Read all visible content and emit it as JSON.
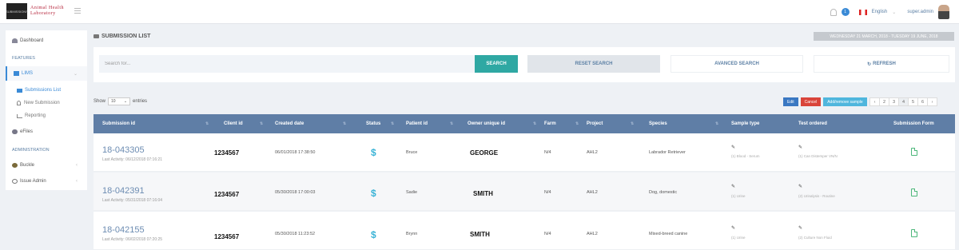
{
  "header": {
    "logo_box_text": "SUBMISSIONS",
    "logo_line1": "Animal Health",
    "logo_line2": "Laboratory",
    "notification_count": "1",
    "language": "English",
    "user": "super.admin"
  },
  "sidebar": {
    "dashboard": "Dashboard",
    "features_heading": "FEATURES",
    "lims": "LIMS",
    "submissions_list": "Submissions List",
    "new_submission": "New Submission",
    "reporting": "Reporting",
    "efiles": "eFiles",
    "admin_heading": "ADMINISTRATION",
    "buckle": "Buckle",
    "issue_admin": "Issue Admin"
  },
  "page": {
    "title": "SUBMISSION LIST",
    "date_range": "WEDNESDAY 21 MARCH, 2018 - TUESDAY 19 JUNE, 2018"
  },
  "search": {
    "placeholder": "Search for...",
    "search_label": "SEARCH",
    "reset_label": "RESET SEARCH",
    "advanced_label": "AVANCED SEARCH",
    "refresh_label": "REFRESH"
  },
  "table_controls": {
    "show_label": "Show",
    "entries_value": "10",
    "entries_label": "entries",
    "edit": "Edit",
    "cancel": "Cancel",
    "add_sample": "Add/remove sample",
    "colors": {
      "edit": "#3a78c2",
      "cancel": "#d9443a",
      "add": "#4fb6dd"
    },
    "pages": [
      "‹",
      "2",
      "3",
      "4",
      "5",
      "6",
      "›"
    ],
    "active_page": "4"
  },
  "columns": [
    "Submission id",
    "Client id",
    "Created date",
    "Status",
    "Patient id",
    "Owner unique id",
    "Farm",
    "Project",
    "Species",
    "Sample type",
    "Test ordered",
    "Submission Form"
  ],
  "rows": [
    {
      "submission_id": "18-043305",
      "last_activity": "Last Activity: 06/12/2018 07:16:21",
      "client_id": "1234567",
      "created": "06/01/2018 17:38:50",
      "status": "$",
      "patient": "Bruce",
      "owner": "GEORGE",
      "farm": "N/4",
      "project": "AHL2",
      "species": "Labrador Retriever",
      "sample_type": "(1) Blood - Serum",
      "test_ordered": "(1) Can Distemper VN/N"
    },
    {
      "submission_id": "18-042391",
      "last_activity": "Last Activity: 05/31/2018 07:16:04",
      "client_id": "1234567",
      "created": "05/30/2018 17:00:03",
      "status": "$",
      "patient": "Sadie",
      "owner": "SMITH",
      "farm": "N/4",
      "project": "AHL2",
      "species": "Dog, domestic",
      "sample_type": "(1) Urine",
      "test_ordered": "(2) Urinalysis - Routine"
    },
    {
      "submission_id": "18-042155",
      "last_activity": "Last Activity: 06/02/2018 07:20:25",
      "client_id": "1234567",
      "created": "05/30/2018 11:23:52",
      "status": "$",
      "patient": "Brynn",
      "owner": "SMITH",
      "farm": "N/4",
      "project": "AHL2",
      "species": "Mixed-breed canine",
      "sample_type": "(1) Urine",
      "test_ordered": "(2) Culture Non Fluid"
    }
  ]
}
